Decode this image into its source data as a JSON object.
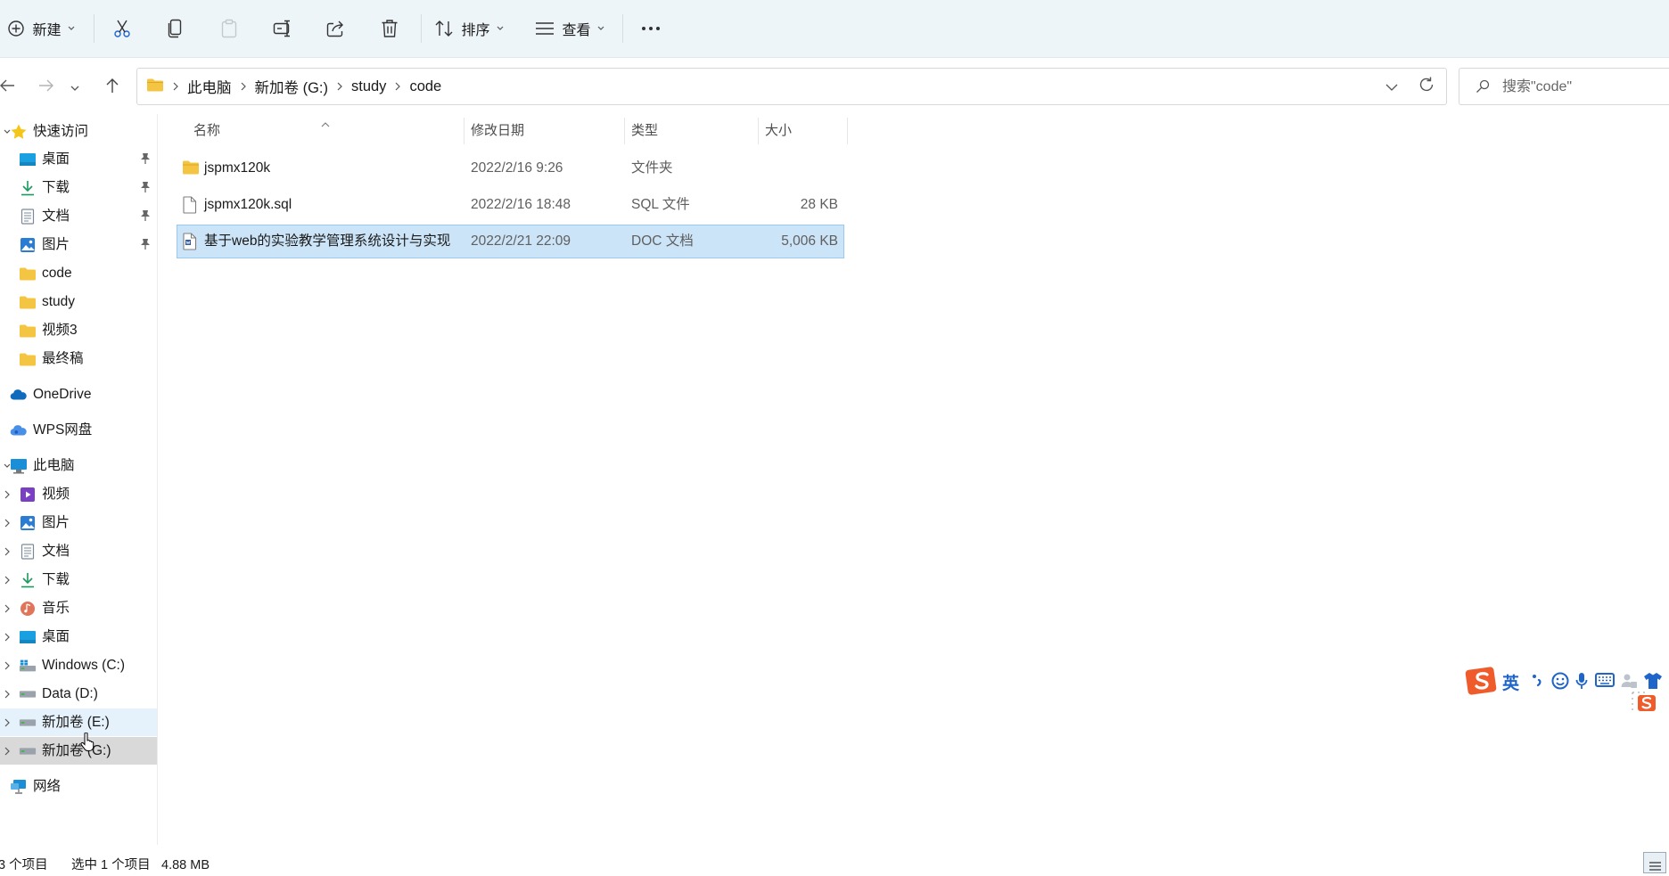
{
  "toolbar": {
    "new_label": "新建",
    "sort_label": "排序",
    "view_label": "查看",
    "more_label": "···"
  },
  "address": {
    "crumbs": [
      "此电脑",
      "新加卷 (G:)",
      "study",
      "code"
    ]
  },
  "search": {
    "placeholder": "搜索\"code\""
  },
  "nav": {
    "quick_access": "快速访问",
    "quick_items": [
      {
        "label": "桌面",
        "pinned": true
      },
      {
        "label": "下载",
        "pinned": true
      },
      {
        "label": "文档",
        "pinned": true
      },
      {
        "label": "图片",
        "pinned": true
      },
      {
        "label": "code",
        "pinned": false
      },
      {
        "label": "study",
        "pinned": false
      },
      {
        "label": "视频3",
        "pinned": false
      },
      {
        "label": "最终稿",
        "pinned": false
      }
    ],
    "onedrive": "OneDrive",
    "wps": "WPS网盘",
    "this_pc": "此电脑",
    "pc_items": [
      "视频",
      "图片",
      "文档",
      "下载",
      "音乐",
      "桌面",
      "Windows (C:)",
      "Data (D:)",
      "新加卷 (E:)",
      "新加卷 (G:)"
    ],
    "network": "网络"
  },
  "columns": {
    "name": "名称",
    "date": "修改日期",
    "type": "类型",
    "size": "大小"
  },
  "files": [
    {
      "name": "jspmx120k",
      "date": "2022/2/16 9:26",
      "type": "文件夹",
      "size": "",
      "icon": "folder-icon"
    },
    {
      "name": "jspmx120k.sql",
      "date": "2022/2/16 18:48",
      "type": "SQL 文件",
      "size": "28 KB",
      "icon": "file-icon"
    },
    {
      "name": "基于web的实验教学管理系统设计与实现",
      "date": "2022/2/21 22:09",
      "type": "DOC 文档",
      "size": "5,006 KB",
      "icon": "doc-icon"
    }
  ],
  "status": {
    "count": "3 个项目",
    "selected": "选中 1 个项目",
    "size": "4.88 MB"
  },
  "ime": {
    "mode_label": "英"
  },
  "colors": {
    "cmdbar_bg": "#eef5f9",
    "selection": "#cce4f7",
    "folder": "#f4c542",
    "accent": "#0067c0"
  }
}
